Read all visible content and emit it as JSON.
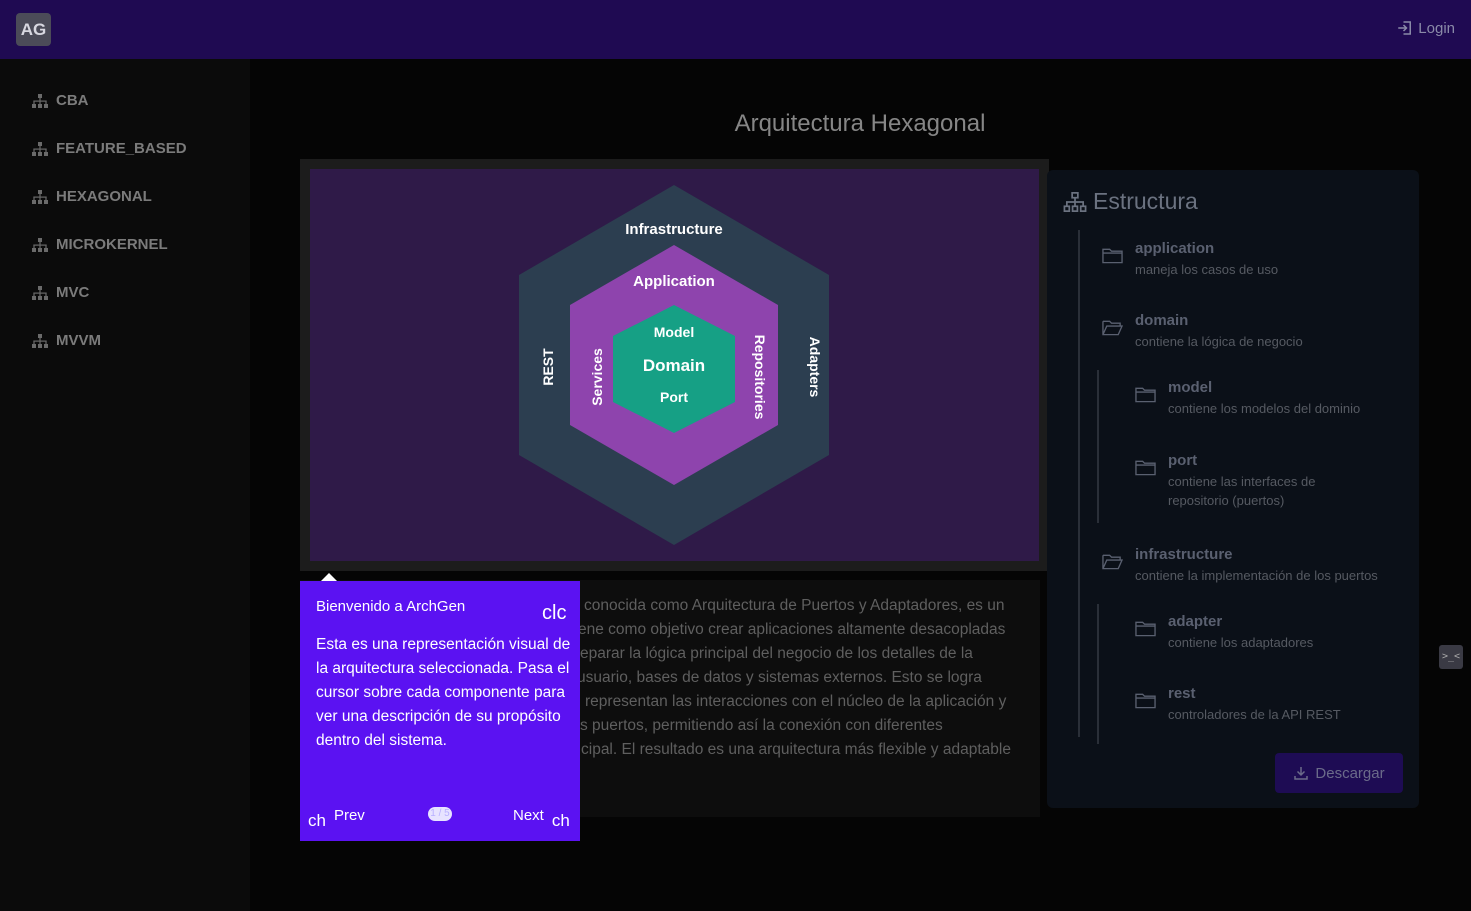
{
  "header": {
    "logo": "AG",
    "login_label": "Login",
    "login_icon": "login-icon"
  },
  "sidebar": {
    "items": [
      {
        "label": "CBA",
        "icon": "sitemap-icon"
      },
      {
        "label": "FEATURE_BASED",
        "icon": "sitemap-icon"
      },
      {
        "label": "HEXAGONAL",
        "icon": "sitemap-icon"
      },
      {
        "label": "MICROKERNEL",
        "icon": "sitemap-icon"
      },
      {
        "label": "MVC",
        "icon": "sitemap-icon"
      },
      {
        "label": "MVVM",
        "icon": "sitemap-icon"
      }
    ]
  },
  "main": {
    "title": "Arquitectura Hexagonal",
    "diagram": {
      "outer_label": "Infrastructure",
      "outer_left": "REST",
      "outer_right": "Adapters",
      "middle_label": "Application",
      "middle_left": "Services",
      "middle_right": "Repositories",
      "inner_top": "Model",
      "inner_center": "Domain",
      "inner_bottom": "Port",
      "colors": {
        "background": "#2f1a48",
        "outer": "#2c3e50",
        "middle": "#8e44ad",
        "inner": "#16a085"
      }
    },
    "description_lines": [
      "conocida como Arquitectura de Puertos y Adaptadores, es un",
      "ene como objetivo crear aplicaciones altamente desacopladas",
      "eparar la lógica principal del negocio de los detalles de la",
      "usuario, bases de datos y sistemas externos. Esto se logra",
      "representan las interacciones con el núcleo de la aplicación y",
      "s puertos, permitiendo así la conexión con diferentes",
      "cipal. El resultado es una arquitectura más flexible y adaptable"
    ]
  },
  "structure": {
    "title": "Estructura",
    "nodes": [
      {
        "name": "application",
        "desc": "maneja los casos de uso"
      },
      {
        "name": "domain",
        "desc": "contiene la lógica de negocio"
      },
      {
        "name": "model",
        "desc": "contiene los modelos del dominio"
      },
      {
        "name": "port",
        "desc": "contiene las interfaces de repositorio (puertos)"
      },
      {
        "name": "infrastructure",
        "desc": "contiene la implementación de los puertos"
      },
      {
        "name": "adapter",
        "desc": "contiene los adaptadores"
      },
      {
        "name": "rest",
        "desc": "controladores de la API REST"
      }
    ],
    "download_label": "Descargar"
  },
  "tour": {
    "title": "Bienvenido a ArchGen",
    "close": "clc",
    "body": "Esta es una representación visual de la arquitectura seleccionada. Pasa el cursor sobre cada componente para ver una descripción de su propósito dentro del sistema.",
    "prev_icon": "ch",
    "prev_label": "Prev",
    "next_label": "Next",
    "next_icon": "ch",
    "counter": "1 / 5"
  },
  "terminal_label": ">_<"
}
